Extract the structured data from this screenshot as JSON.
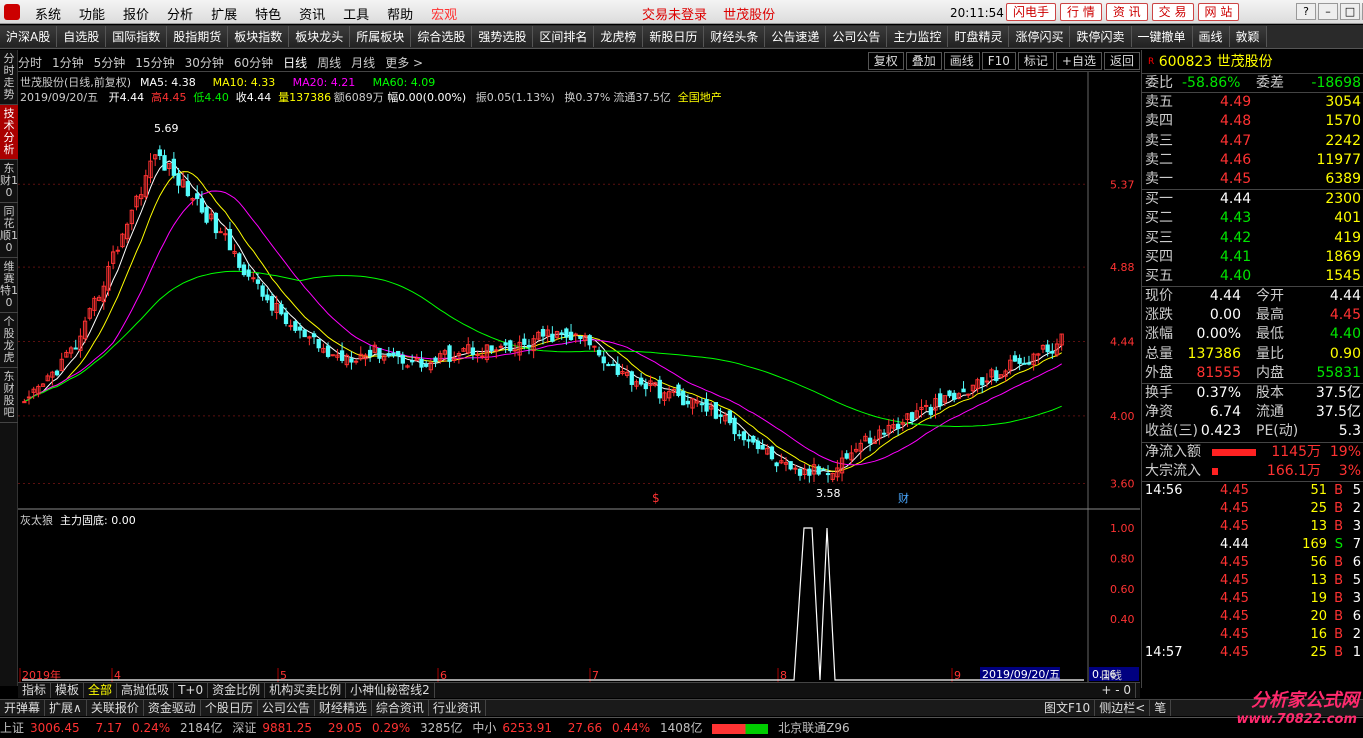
{
  "menubar": {
    "items": [
      "系统",
      "功能",
      "报价",
      "分析",
      "扩展",
      "特色",
      "资讯",
      "工具",
      "帮助",
      "宏观"
    ],
    "trade_status": "交易未登录",
    "stock_name": "世茂股份",
    "clock": "20:11:54 周五",
    "quick_buttons": [
      "闪电手",
      "行 情",
      "资 讯",
      "交 易",
      "网 站"
    ],
    "window_controls": [
      "?",
      "–",
      "□",
      "✕"
    ]
  },
  "toolbar": {
    "items": [
      "沪深A股",
      "自选股",
      "国际指数",
      "股指期货",
      "板块指数",
      "板块龙头",
      "所属板块",
      "综合选股",
      "强势选股",
      "区间排名",
      "龙虎榜",
      "新股日历",
      "财经头条",
      "公告速递",
      "公司公告",
      "主力监控",
      "盯盘精灵",
      "涨停闪买",
      "跌停闪卖",
      "一键撤单",
      "画线",
      "敦颖"
    ]
  },
  "left_tabs": [
    {
      "label": "分时走势",
      "active": false
    },
    {
      "label": "技术分析",
      "active": true
    },
    {
      "label": "东财10",
      "active": false
    },
    {
      "label": "同花顺10",
      "active": false
    },
    {
      "label": "维赛特10",
      "active": false
    },
    {
      "label": "个股龙虎",
      "active": false
    },
    {
      "label": "东财股吧",
      "active": false
    }
  ],
  "periods": {
    "items": [
      "分时",
      "1分钟",
      "5分钟",
      "15分钟",
      "30分钟",
      "60分钟",
      "日线",
      "周线",
      "月线",
      "更多 >"
    ],
    "active": "日线",
    "right_buttons": [
      "复权",
      "叠加",
      "画线",
      "F10",
      "标记",
      "+自选",
      "返回"
    ]
  },
  "info": {
    "title": "世茂股份(日线,前复权)",
    "ma5": "MA5: 4.38",
    "ma10": "MA10: 4.33",
    "ma20": "MA20: 4.21",
    "ma60": "MA60: 4.09",
    "date": "2019/09/20/五",
    "open": "开4.44",
    "high": "高4.45",
    "low": "低4.40",
    "close": "收4.44",
    "volume": "量137386",
    "amount": "额6089万",
    "change": "幅0.00(0.00%)",
    "amplitude": "振0.05(1.13%)",
    "turnover": "换0.37%",
    "float": "流通37.5亿",
    "sector": "全国地产"
  },
  "chart_data": {
    "type": "candlestick",
    "price_axis_ticks": [
      "5.37",
      "4.88",
      "4.44",
      "4.00",
      "3.60"
    ],
    "price_range": [
      3.55,
      5.75
    ],
    "high_label": "5.69",
    "low_label": "3.58",
    "indicator_title": "灰太狼",
    "indicator_label": "主力固底: 0.00",
    "indicator_axis_ticks": [
      "1.00",
      "0.80",
      "0.60",
      "0.40"
    ],
    "indicator_current": "0.16",
    "x_axis_labels": [
      "2019年",
      "4",
      "5",
      "6",
      "7",
      "8",
      "9"
    ],
    "x_axis_current": "2019/09/20/五",
    "period_label": "日线",
    "markers": [
      "$",
      "财"
    ],
    "colors": {
      "up": "#ff3232",
      "down": "#54fcfc",
      "ma5": "#ffffff",
      "ma10": "#ffff00",
      "ma20": "#ff00ff",
      "ma60": "#00ff00"
    }
  },
  "quote": {
    "code": "600823",
    "name": "世茂股份",
    "flag": "R",
    "weibi_label": "委比",
    "weibi": "-58.86%",
    "weicha_label": "委差",
    "weicha": "-18698",
    "sells": [
      {
        "label": "卖五",
        "price": "4.49",
        "vol": "3054"
      },
      {
        "label": "卖四",
        "price": "4.48",
        "vol": "1570"
      },
      {
        "label": "卖三",
        "price": "4.47",
        "vol": "2242"
      },
      {
        "label": "卖二",
        "price": "4.46",
        "vol": "11977"
      },
      {
        "label": "卖一",
        "price": "4.45",
        "vol": "6389"
      }
    ],
    "buys": [
      {
        "label": "买一",
        "price": "4.44",
        "vol": "2300"
      },
      {
        "label": "买二",
        "price": "4.43",
        "vol": "401"
      },
      {
        "label": "买三",
        "price": "4.42",
        "vol": "419"
      },
      {
        "label": "买四",
        "price": "4.41",
        "vol": "1869"
      },
      {
        "label": "买五",
        "price": "4.40",
        "vol": "1545"
      }
    ],
    "stats": [
      {
        "l1": "现价",
        "v1": "4.44",
        "l2": "今开",
        "v2": "4.44"
      },
      {
        "l1": "涨跌",
        "v1": "0.00",
        "l2": "最高",
        "v2": "4.45"
      },
      {
        "l1": "涨幅",
        "v1": "0.00%",
        "l2": "最低",
        "v2": "4.40"
      },
      {
        "l1": "总量",
        "v1": "137386",
        "l2": "量比",
        "v2": "0.90"
      },
      {
        "l1": "外盘",
        "v1": "81555",
        "l2": "内盘",
        "v2": "55831"
      }
    ],
    "stats2": [
      {
        "l1": "换手",
        "v1": "0.37%",
        "l2": "股本",
        "v2": "37.5亿"
      },
      {
        "l1": "净资",
        "v1": "6.74",
        "l2": "流通",
        "v2": "37.5亿"
      },
      {
        "l1": "收益(三)",
        "v1": "0.423",
        "l2": "PE(动)",
        "v2": "5.3"
      }
    ],
    "flows": [
      {
        "label": "净流入额",
        "value": "1145万",
        "pct": "19%"
      },
      {
        "label": "大宗流入",
        "value": "166.1万",
        "pct": "3%"
      }
    ],
    "ticks": [
      {
        "time": "14:56",
        "price": "4.45",
        "qty": "51",
        "side": "B",
        "n": "5"
      },
      {
        "time": "",
        "price": "4.45",
        "qty": "25",
        "side": "B",
        "n": "2"
      },
      {
        "time": "",
        "price": "4.45",
        "qty": "13",
        "side": "B",
        "n": "3"
      },
      {
        "time": "",
        "price": "4.44",
        "qty": "169",
        "side": "S",
        "n": "7"
      },
      {
        "time": "",
        "price": "4.45",
        "qty": "56",
        "side": "B",
        "n": "6"
      },
      {
        "time": "",
        "price": "4.45",
        "qty": "13",
        "side": "B",
        "n": "5"
      },
      {
        "time": "",
        "price": "4.45",
        "qty": "19",
        "side": "B",
        "n": "3"
      },
      {
        "time": "",
        "price": "4.45",
        "qty": "20",
        "side": "B",
        "n": "6"
      },
      {
        "time": "",
        "price": "4.45",
        "qty": "16",
        "side": "B",
        "n": "2"
      },
      {
        "time": "14:57",
        "price": "4.45",
        "qty": "25",
        "side": "B",
        "n": "1"
      }
    ]
  },
  "indicator_tabs": {
    "items": [
      "指标",
      "模板",
      "全部",
      "高抛低吸",
      "T+0",
      "资金比例",
      "机构买卖比例",
      "小神仙秘密线2"
    ],
    "active": "全部",
    "controls": "+ - 0"
  },
  "func_bar": {
    "items": [
      "开弹幕",
      "扩展∧",
      "关联报价",
      "资金驱动",
      "个股日历",
      "公司公告",
      "财经精选",
      "综合资讯",
      "行业资讯"
    ],
    "right": [
      "图文F10",
      "侧边栏<",
      "笔"
    ]
  },
  "status": {
    "sh_label": "上证",
    "sh_value": "3006.45",
    "sh_change": "7.17",
    "sh_pct": "0.24%",
    "sh_amount": "2184亿",
    "sz_label": "深证",
    "sz_value": "9881.25",
    "sz_change": "29.05",
    "sz_pct": "0.29%",
    "sz_amount": "3285亿",
    "zx_label": "中小",
    "zx_value": "6253.91",
    "zx_change": "27.66",
    "zx_pct": "0.44%",
    "zx_amount": "1408亿",
    "server": "北京联通Z96"
  },
  "brand": {
    "line1": "分析家公式网",
    "line2": "www.70822.com"
  }
}
